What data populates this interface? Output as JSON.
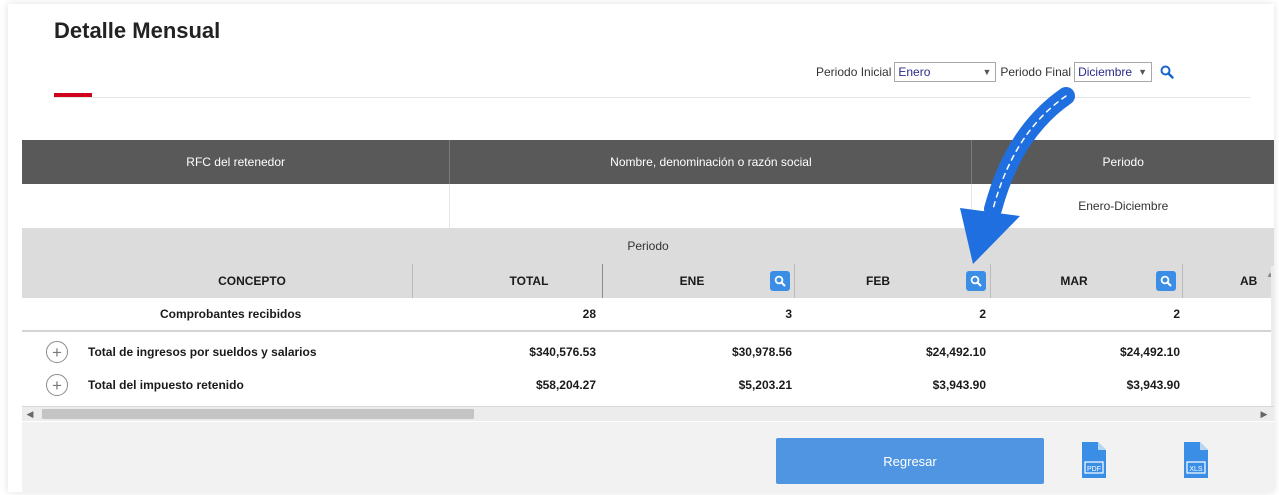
{
  "page": {
    "title": "Detalle Mensual"
  },
  "filters": {
    "inicial_label": "Periodo Inicial",
    "inicial_value": "Enero",
    "final_label": "Periodo Final",
    "final_value": "Diciembre"
  },
  "retenedor_table": {
    "headers": [
      "RFC del retenedor",
      "Nombre, denominación o razón social",
      "Periodo"
    ],
    "row": [
      "",
      "",
      "Enero-Diciembre"
    ]
  },
  "monthly_table": {
    "group_header": "Periodo",
    "columns": [
      "CONCEPTO",
      "TOTAL",
      "ENE",
      "FEB",
      "MAR",
      "AB"
    ],
    "rows": [
      {
        "concepto": "Comprobantes recibidos",
        "values": [
          "28",
          "3",
          "2",
          "2"
        ]
      },
      {
        "concepto": "Total de ingresos por sueldos y salarios",
        "values": [
          "$340,576.53",
          "$30,978.56",
          "$24,492.10",
          "$24,492.10"
        ]
      },
      {
        "concepto": "Total del impuesto retenido",
        "values": [
          "$58,204.27",
          "$5,203.21",
          "$3,943.90",
          "$3,943.90"
        ]
      }
    ]
  },
  "footer": {
    "regresar_label": "Regresar",
    "pdf_label": "PDF",
    "xls_label": "XLS"
  },
  "colors": {
    "accent_blue": "#3a8ee6",
    "header_dark": "#595959",
    "red_underline": "#d0021b",
    "annotation_arrow": "#1f6fe0"
  }
}
